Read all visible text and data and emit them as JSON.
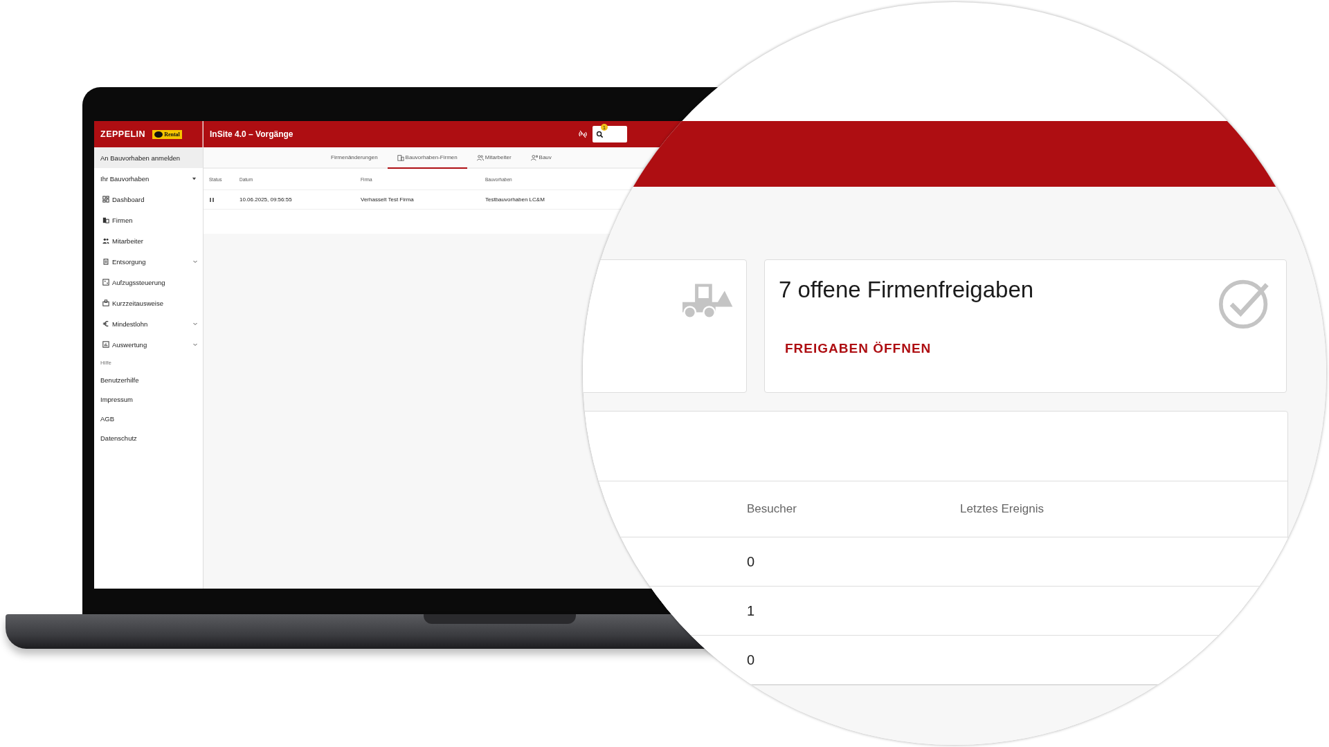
{
  "app": {
    "logo": "ZEPPELIN",
    "badge": "Rental"
  },
  "header": {
    "title": "InSite 4.0 – Vorgänge",
    "notification_count": "1"
  },
  "sidebar": {
    "top_item": {
      "label": "An Bauvorhaben anmelden",
      "selected": true
    },
    "group": {
      "label": "Ihr Bauvorhaben",
      "expanded": true,
      "items": [
        {
          "label": "Dashboard",
          "expandable": false
        },
        {
          "label": "Firmen",
          "expandable": false
        },
        {
          "label": "Mitarbeiter",
          "expandable": false
        },
        {
          "label": "Entsorgung",
          "expandable": true,
          "expanded": false
        },
        {
          "label": "Aufzugssteuerung",
          "expandable": false
        },
        {
          "label": "Kurzzeitausweise",
          "expandable": false
        },
        {
          "label": "Mindestlohn",
          "expandable": true,
          "expanded": false
        },
        {
          "label": "Auswertung",
          "expandable": true,
          "expanded": false
        }
      ]
    },
    "help": {
      "label": "Hilfe",
      "items": [
        "Benutzerhilfe",
        "Impressum",
        "AGB",
        "Datenschutz"
      ]
    }
  },
  "tabs": [
    {
      "label": "Firmenänderungen",
      "selected": false
    },
    {
      "label": "Bauvorhaben-Firmen",
      "selected": true
    },
    {
      "label": "Mitarbeiter",
      "selected": false
    },
    {
      "label": "Bauv",
      "selected": false
    }
  ],
  "table": {
    "columns": [
      "Status",
      "Datum",
      "Firma",
      "Bauvorhaben"
    ],
    "rows": [
      {
        "paused": true,
        "datum": "10.06.2025, 09:56:55",
        "firma": "Verhasselt Test Firma",
        "bauvorhaben": "Testbauvorhaben LC&M"
      }
    ]
  },
  "zoom": {
    "cards": [
      {
        "kind": "machine"
      },
      {
        "kind": "approvals",
        "title": "7 offene Firmenfreigaben",
        "action": "FREIGABEN ÖFFNEN"
      }
    ],
    "table": {
      "columns": [
        "Besucher",
        "Letztes Ereignis"
      ],
      "rows": [
        {
          "besucher": "0"
        },
        {
          "besucher": "1"
        },
        {
          "besucher": "0"
        }
      ]
    }
  }
}
